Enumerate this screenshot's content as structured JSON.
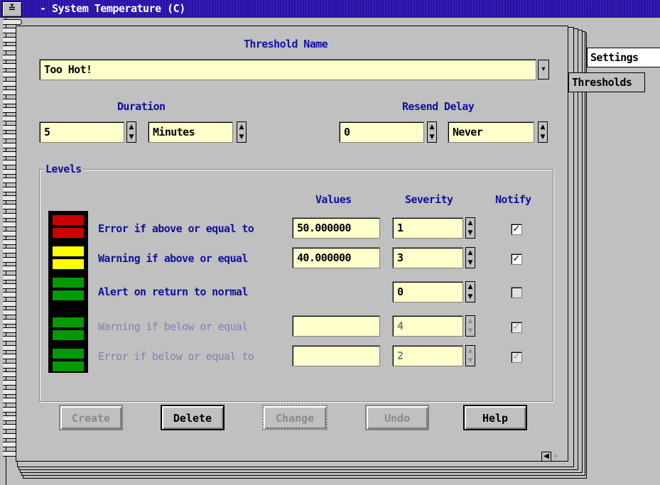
{
  "window": {
    "title": "- System Temperature (C)",
    "sysmenu_glyph": "≚"
  },
  "tabs": [
    {
      "label": "Settings"
    },
    {
      "label": "Thresholds"
    }
  ],
  "threshold_name": {
    "label": "Threshold Name",
    "value": "Too Hot!"
  },
  "duration": {
    "label": "Duration",
    "value": "5",
    "unit": "Minutes"
  },
  "resend_delay": {
    "label": "Resend Delay",
    "value": "0",
    "unit": "Never"
  },
  "levels": {
    "title": "Levels",
    "col_values": "Values",
    "col_severity": "Severity",
    "col_notify": "Notify",
    "rows": [
      {
        "label": "Error if above or equal to",
        "value": "50.000000",
        "severity": "1",
        "notify": true,
        "enabled": true
      },
      {
        "label": "Warning if above or equal",
        "value": "40.000000",
        "severity": "3",
        "notify": true,
        "enabled": true
      },
      {
        "label": "Alert on return to normal",
        "value": "",
        "severity": "0",
        "notify": false,
        "enabled": true
      },
      {
        "label": "Warning if below or equal",
        "value": "",
        "severity": "4",
        "notify": true,
        "enabled": false
      },
      {
        "label": "Error if below or equal to",
        "value": "",
        "severity": "2",
        "notify": true,
        "enabled": false
      }
    ]
  },
  "meter_colors": {
    "red": "#cc0000",
    "yellow": "#ffff00",
    "green": "#009900",
    "frame": "#000000"
  },
  "buttons": {
    "create": "Create",
    "delete": "Delete",
    "change": "Change",
    "undo": "Undo",
    "help": "Help"
  },
  "icons": {
    "spinner": "up-down-arrow-icon",
    "dropdown": "dropdown-icon",
    "check": "checkmark-icon",
    "nav": "page-nav-icon"
  }
}
